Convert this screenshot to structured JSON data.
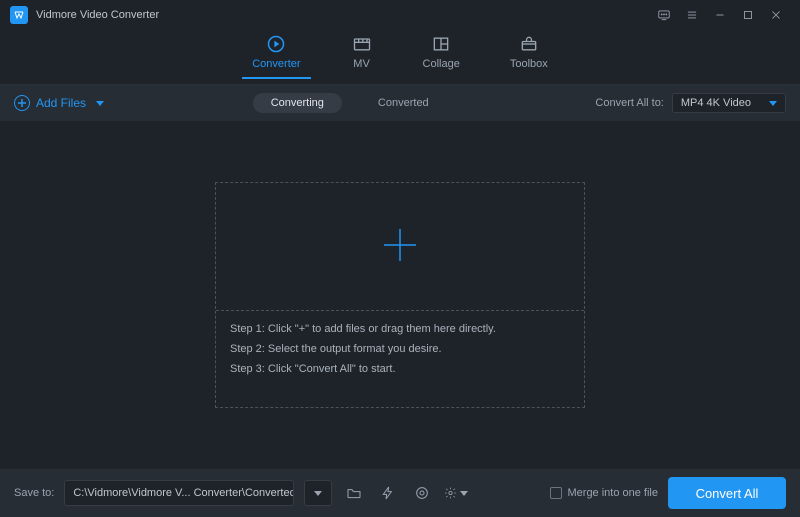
{
  "app": {
    "title": "Vidmore Video Converter"
  },
  "tabs_main": [
    {
      "label": "Converter",
      "active": true
    },
    {
      "label": "MV",
      "active": false
    },
    {
      "label": "Collage",
      "active": false
    },
    {
      "label": "Toolbox",
      "active": false
    }
  ],
  "toolbar": {
    "add_files_label": "Add Files",
    "sub_tabs": [
      {
        "label": "Converting",
        "active": true
      },
      {
        "label": "Converted",
        "active": false
      }
    ],
    "convert_all_to_label": "Convert All to:",
    "format_selected": "MP4 4K Video"
  },
  "dropzone": {
    "step1": "Step 1: Click \"+\" to add files or drag them here directly.",
    "step2": "Step 2: Select the output format you desire.",
    "step3": "Step 3: Click \"Convert All\" to start."
  },
  "bottom": {
    "save_to_label": "Save to:",
    "path": "C:\\Vidmore\\Vidmore V... Converter\\Converted",
    "merge_label": "Merge into one file",
    "convert_all_btn": "Convert All"
  }
}
